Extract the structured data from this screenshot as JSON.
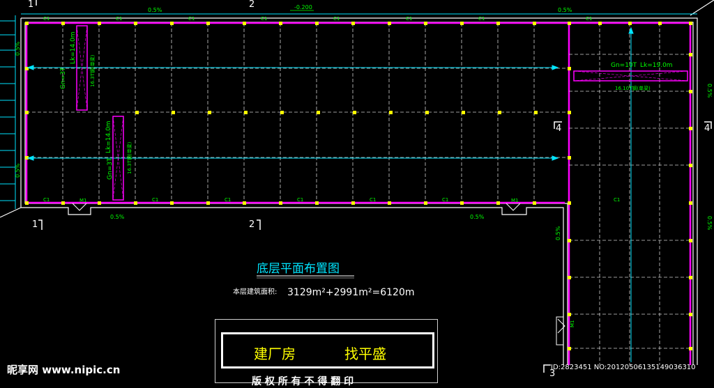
{
  "drawing": {
    "title": "底层平面布置图",
    "area_label": "本层建筑面积:",
    "area_formula": "3129m²+2991m²=6120m",
    "title_block": {
      "left_text": "建厂房",
      "right_text": "找平盛",
      "bottom_text": "版 权 所 有  不 得 翻 印"
    },
    "axes": {
      "top": [
        "1",
        "2"
      ],
      "bottom": [
        "1",
        "2",
        "3"
      ],
      "right": [
        "4",
        "4"
      ]
    },
    "slope_labels": [
      "0.5%",
      "0.5%",
      "0.5%",
      "0.5%",
      "0.5%",
      "0.5%",
      "0.5%",
      "0.5%",
      "0.5%"
    ],
    "elevation_label": "-0.200",
    "column_tag": "C1",
    "door_tag": "M1",
    "cranes": [
      {
        "gn": "Gn=3T",
        "lk": "Lk=14.0m",
        "spec": "16.3T钢(单梁)"
      },
      {
        "gn": "Gn=3T",
        "lk": "Lk=14.0m",
        "spec": "16.3T钢(单梁)"
      },
      {
        "gn": "Gn=10T",
        "lk": "Lk=19.0m",
        "spec": "16.10T钢(单梁)"
      }
    ]
  },
  "watermark": {
    "logo": "昵享网 www.nipic.cn",
    "id_line": "ID:2823451 NO:20120506135149036310"
  },
  "colors": {
    "background": "#000000",
    "wall": "#ff00ff",
    "outline": "#ffffff",
    "grid": "#d0d0d0",
    "column": "#ffff00",
    "dimension": "#00e5ff",
    "label": "#00ff00"
  }
}
